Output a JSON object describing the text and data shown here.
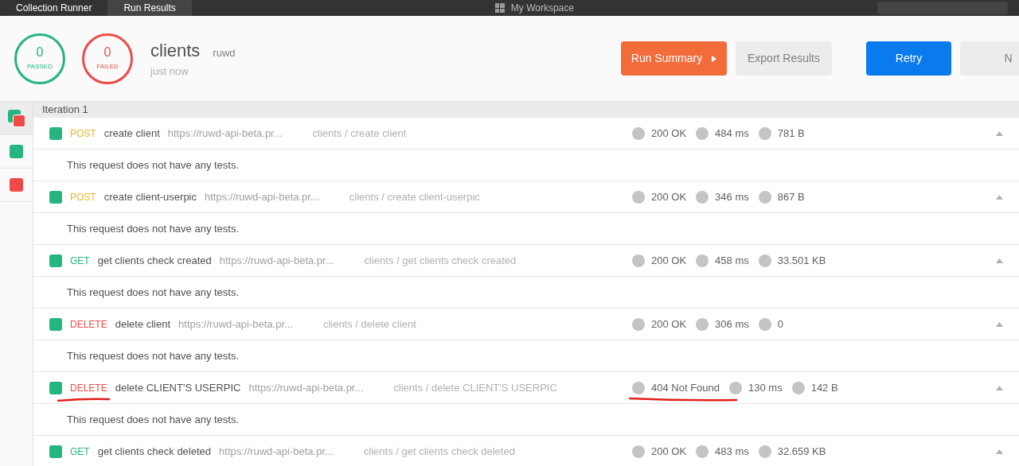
{
  "top_bar": {
    "tabs": [
      {
        "label": "Collection Runner",
        "selected": false
      },
      {
        "label": "Run Results",
        "selected": true
      }
    ],
    "workspace": "My Workspace"
  },
  "summary": {
    "passed": {
      "count": "0",
      "label": "PASSED"
    },
    "failed": {
      "count": "0",
      "label": "FAILED"
    },
    "collection": "clients",
    "environment": "ruwd",
    "time": "just now"
  },
  "buttons": [
    {
      "label": "Run Summary",
      "kind": "primary"
    },
    {
      "label": "Export Results",
      "kind": "secondary"
    },
    {
      "label": "Retry",
      "kind": "action"
    },
    {
      "label": "N",
      "kind": "secondary"
    }
  ],
  "sidebar": {
    "items": [
      {
        "kind": "mixed",
        "selected": true
      },
      {
        "kind": "pass",
        "selected": false
      },
      {
        "kind": "fail",
        "selected": false
      }
    ]
  },
  "iteration": "Iteration 1",
  "requests": [
    {
      "passed": true,
      "method": "POST",
      "color": "#f0b429",
      "name": "create client",
      "url": "https://ruwd-api-beta.pr...",
      "path": "clients / create client",
      "status": "200 OK",
      "time": "484 ms",
      "size": "781 B",
      "message": "This request does not have any tests.",
      "underlined": false
    },
    {
      "passed": true,
      "method": "POST",
      "color": "#f0b429",
      "name": "create client-userpic",
      "url": "https://ruwd-api-beta.pr...",
      "path": "clients / create client-userpic",
      "status": "200 OK",
      "time": "346 ms",
      "size": "867 B",
      "message": "This request does not have any tests.",
      "underlined": false
    },
    {
      "passed": true,
      "method": "GET",
      "color": "#26b47f",
      "name": "get clients check created",
      "url": "https://ruwd-api-beta.pr...",
      "path": "clients / get clients check created",
      "status": "200 OK",
      "time": "458 ms",
      "size": "33.501 KB",
      "message": "This request does not have any tests.",
      "underlined": false
    },
    {
      "passed": true,
      "method": "DELETE",
      "color": "#ed4b48",
      "name": "delete client",
      "url": "https://ruwd-api-beta.pr...",
      "path": "clients / delete client",
      "status": "200 OK",
      "time": "306 ms",
      "size": "0",
      "message": "This request does not have any tests.",
      "underlined": false
    },
    {
      "passed": true,
      "method": "DELETE",
      "color": "#ed4b48",
      "name": "delete CLIENT'S USERPIC",
      "url": "https://ruwd-api-beta.pr...",
      "path": "clients / delete CLIENT'S USERPIC",
      "status": "404 Not Found",
      "time": "130 ms",
      "size": "142 B",
      "message": "This request does not have any tests.",
      "underlined": true
    },
    {
      "passed": true,
      "method": "GET",
      "color": "#26b47f",
      "name": "get clients check deleted",
      "url": "https://ruwd-api-beta.pr...",
      "path": "clients / get clients check deleted",
      "status": "200 OK",
      "time": "483 ms",
      "size": "32.659 KB",
      "underlined": false
    }
  ]
}
